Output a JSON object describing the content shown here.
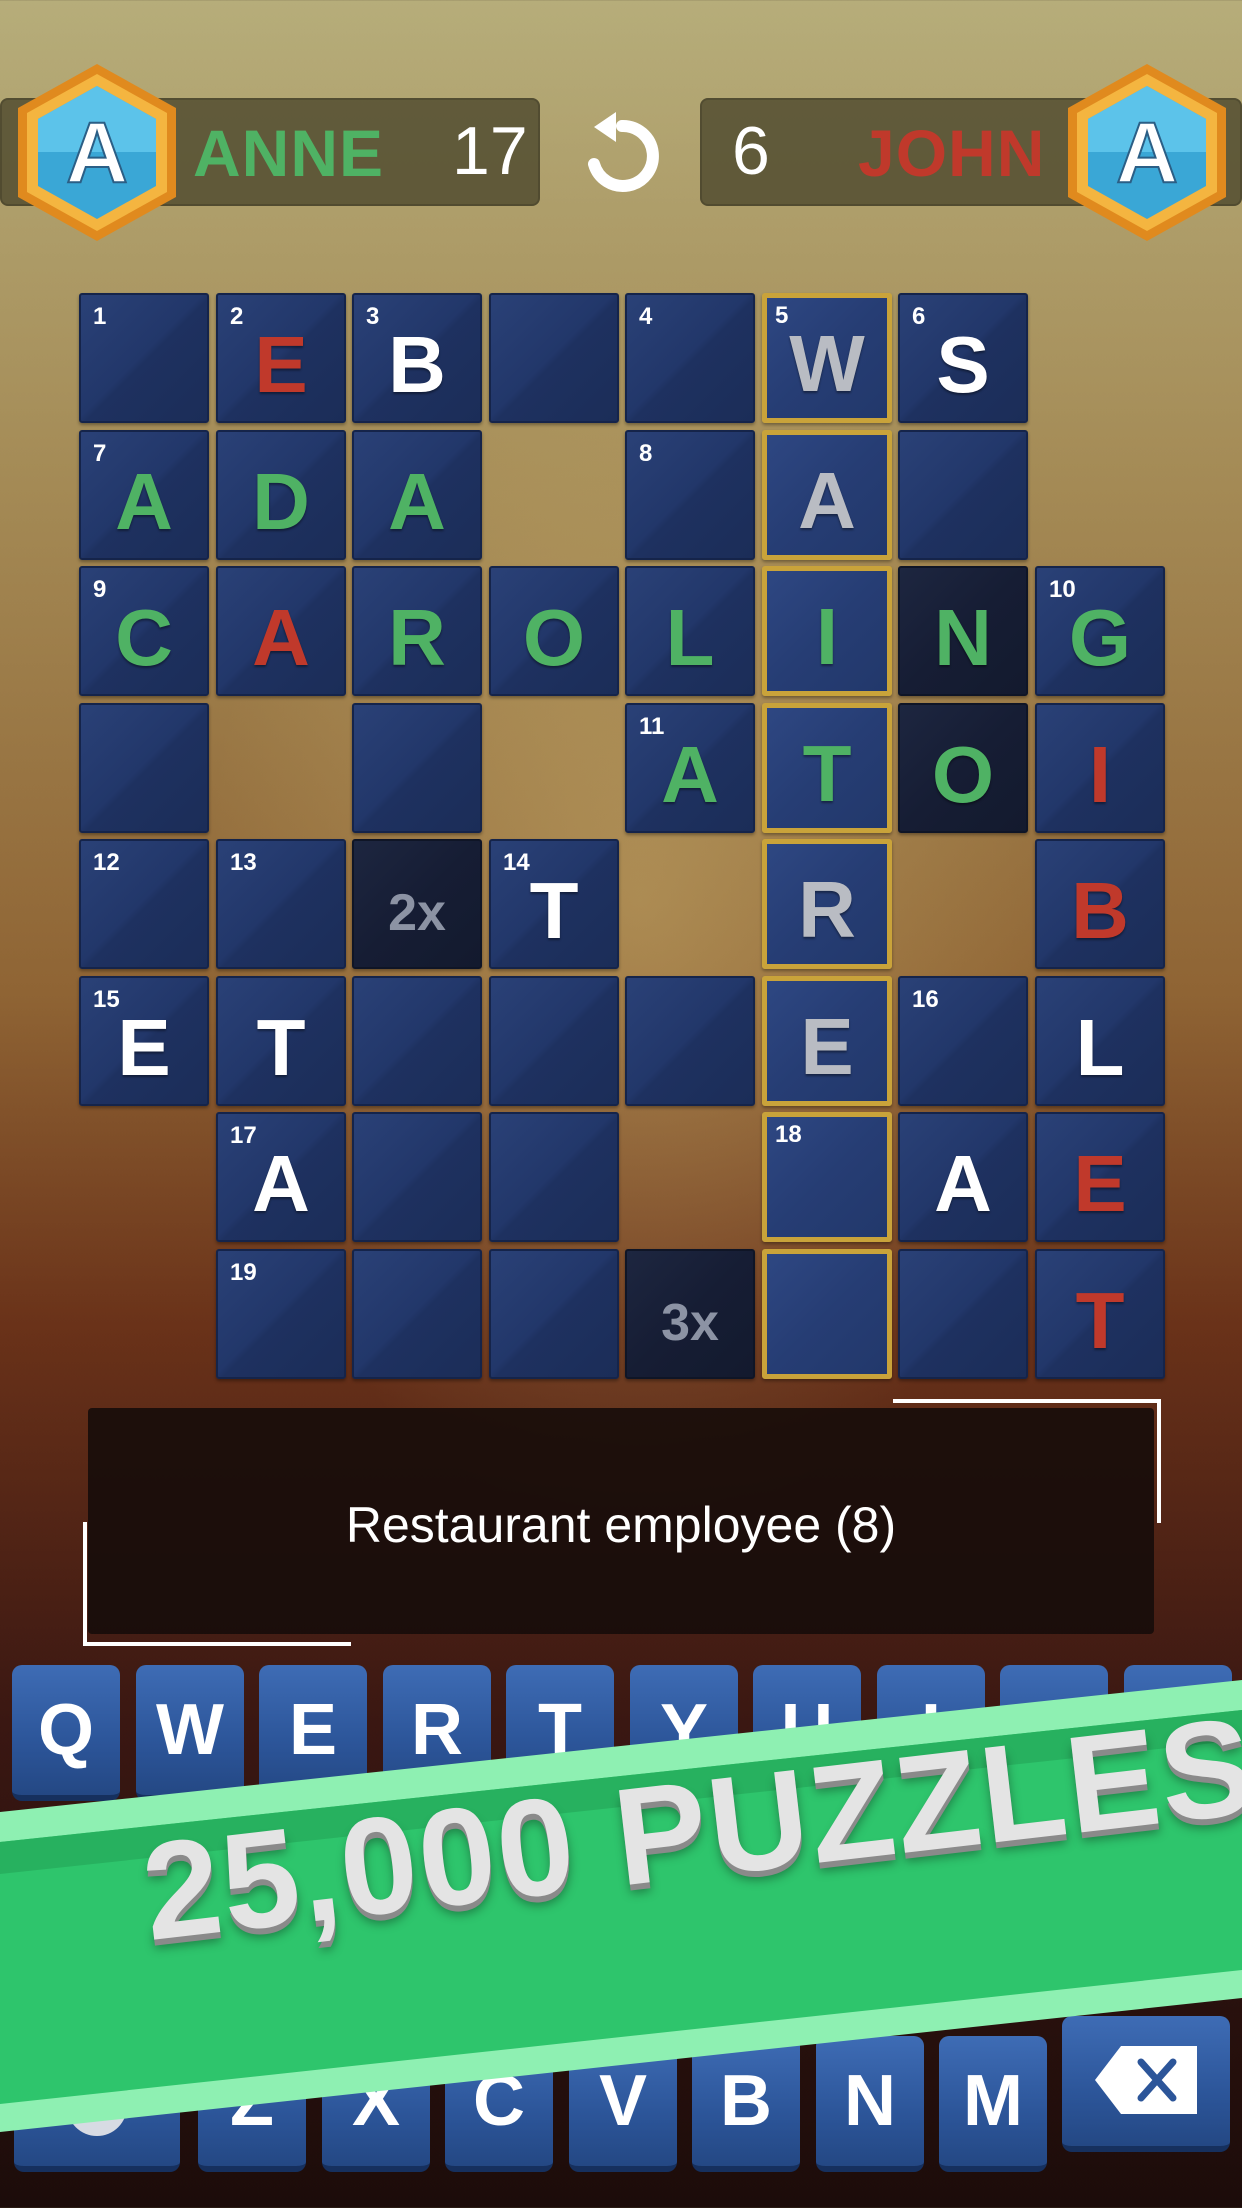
{
  "header": {
    "player1": {
      "name": "ANNE",
      "score": "17",
      "avatar_letter": "A"
    },
    "player2": {
      "name": "JOHN",
      "score": "6",
      "avatar_letter": "A"
    },
    "undo_icon": "undo-icon"
  },
  "board": {
    "rows": [
      [
        {
          "n": "1"
        },
        {
          "n": "2",
          "l": "E",
          "c": "red"
        },
        {
          "n": "3",
          "l": "B",
          "c": "white"
        },
        {},
        {
          "n": "4"
        },
        {
          "n": "5",
          "l": "W",
          "c": "gray",
          "sel": true
        },
        {
          "n": "6",
          "l": "S",
          "c": "white"
        },
        null
      ],
      [
        {
          "n": "7",
          "l": "A",
          "c": "green"
        },
        {
          "l": "D",
          "c": "green"
        },
        {
          "l": "A",
          "c": "green"
        },
        null,
        {
          "n": "8"
        },
        {
          "l": "A",
          "c": "gray",
          "sel": true
        },
        {},
        null
      ],
      [
        {
          "n": "9",
          "l": "C",
          "c": "green"
        },
        {
          "l": "A",
          "c": "red"
        },
        {
          "l": "R",
          "c": "green"
        },
        {
          "l": "O",
          "c": "green"
        },
        {
          "l": "L",
          "c": "green"
        },
        {
          "l": "I",
          "c": "green",
          "sel": true
        },
        {
          "l": "N",
          "c": "green",
          "dark": true
        },
        {
          "n": "10",
          "l": "G",
          "c": "green"
        }
      ],
      [
        {},
        null,
        {},
        null,
        {
          "n": "11",
          "l": "A",
          "c": "green"
        },
        {
          "l": "T",
          "c": "green",
          "sel": true
        },
        {
          "l": "O",
          "c": "green",
          "dark": true
        },
        {
          "l": "I",
          "c": "red"
        }
      ],
      [
        {
          "n": "12"
        },
        {
          "n": "13"
        },
        {
          "b": "2x",
          "dark": true
        },
        {
          "n": "14",
          "l": "T",
          "c": "white"
        },
        null,
        {
          "l": "R",
          "c": "gray",
          "sel": true
        },
        null,
        {
          "l": "B",
          "c": "red"
        }
      ],
      [
        {
          "n": "15",
          "l": "E",
          "c": "white"
        },
        {
          "l": "T",
          "c": "white"
        },
        {},
        {},
        {},
        {
          "l": "E",
          "c": "gray",
          "sel": true
        },
        {
          "n": "16"
        },
        {
          "l": "L",
          "c": "white"
        }
      ],
      [
        null,
        {
          "n": "17",
          "l": "A",
          "c": "white"
        },
        {},
        {},
        null,
        {
          "n": "18",
          "sel": true
        },
        {
          "l": "A",
          "c": "white"
        },
        {
          "l": "E",
          "c": "red"
        }
      ],
      [
        null,
        {
          "n": "19"
        },
        {},
        {},
        {
          "b": "3x",
          "dark": true
        },
        {
          "sel": true
        },
        {},
        {
          "l": "T",
          "c": "red"
        }
      ]
    ]
  },
  "clue": {
    "text": "Restaurant employee (8)"
  },
  "keyboard": {
    "row1": [
      "Q",
      "W",
      "E",
      "R",
      "T",
      "Y",
      "U",
      "I",
      "O",
      "P"
    ],
    "row3": [
      "Z",
      "X",
      "C",
      "V",
      "B",
      "N",
      "M"
    ],
    "backspace_icon": "backspace-icon",
    "extra_icon": "settings-icon"
  },
  "banner": {
    "text": "25,000 PUZZLES!"
  },
  "colors": {
    "green": "#4fb264",
    "red": "#c0392b",
    "white": "#ffffff",
    "gray": "#b9bcc3",
    "tile": "#22376a",
    "selected_border": "#c9a33a",
    "banner_green": "#2ec56c"
  }
}
